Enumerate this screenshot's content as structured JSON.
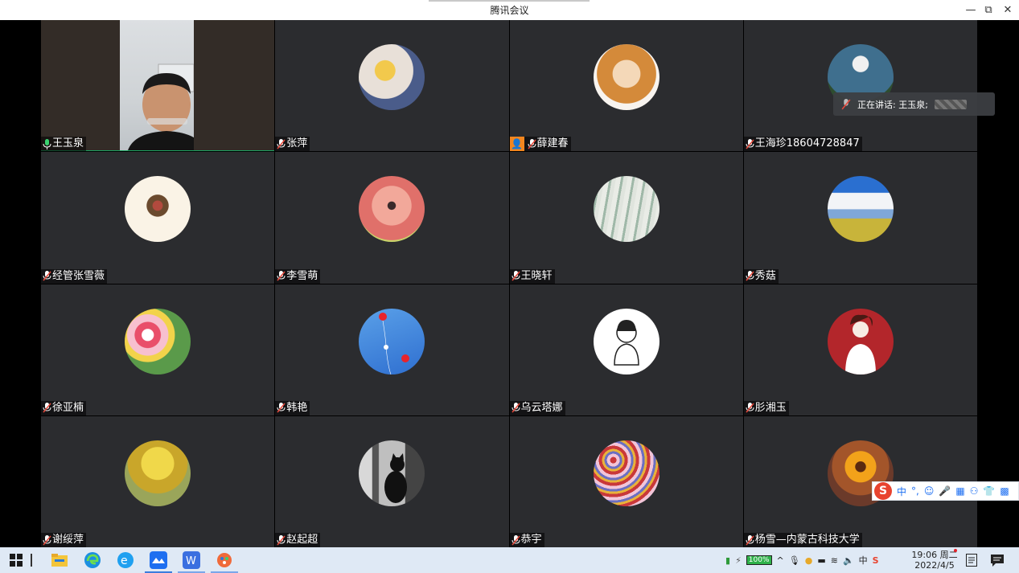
{
  "window": {
    "title": "腾讯会议",
    "minimize": "—",
    "restore": "⧉",
    "close": "✕"
  },
  "participants": [
    {
      "name": "王玉泉",
      "mic": "on",
      "video": true
    },
    {
      "name": "张萍",
      "mic": "muted"
    },
    {
      "name": "薛建春",
      "mic": "muted",
      "host_badge": true
    },
    {
      "name": "王海珍18604728847",
      "mic": "muted"
    },
    {
      "name": "经管张雪薇",
      "mic": "muted"
    },
    {
      "name": "李雪萌",
      "mic": "muted"
    },
    {
      "name": "王晓轩",
      "mic": "muted"
    },
    {
      "name": "秀菇",
      "mic": "muted"
    },
    {
      "name": "徐亚楠",
      "mic": "muted"
    },
    {
      "name": "韩艳",
      "mic": "muted"
    },
    {
      "name": "乌云塔娜",
      "mic": "muted"
    },
    {
      "name": "肜湘玉",
      "mic": "muted"
    },
    {
      "name": "谢绥萍",
      "mic": "muted"
    },
    {
      "name": "赵起超",
      "mic": "muted"
    },
    {
      "name": "恭宇",
      "mic": "muted"
    },
    {
      "name": "杨雪—内蒙古科技大学",
      "mic": "muted"
    }
  ],
  "speaking": {
    "label": "正在讲话: 王玉泉;"
  },
  "ime": {
    "mode": "中",
    "punct": "°,"
  },
  "taskbar": {
    "battery": "100%",
    "lang": "中",
    "time": "19:06 周二",
    "date": "2022/4/5"
  },
  "colors": {
    "tile_bg": "#2b2c2f",
    "active_border": "#1fa463",
    "host_badge": "#f2861f",
    "taskbar_bg": "#dfe9f5"
  }
}
